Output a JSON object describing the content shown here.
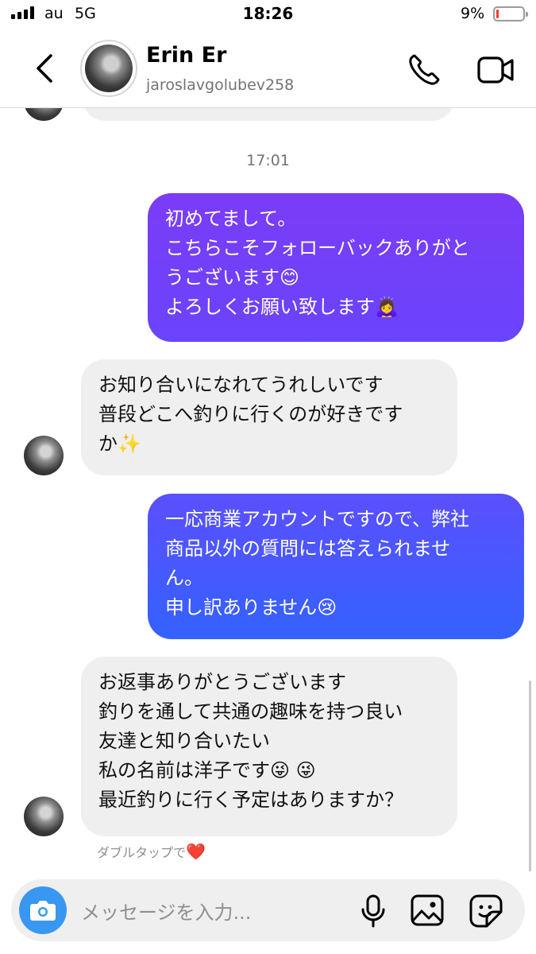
{
  "status_bar": {
    "carrier": "au",
    "network": "5G",
    "time": "18:26",
    "battery_percent": "9%",
    "battery_level": 0.09,
    "battery_color": "#ff3b30"
  },
  "header": {
    "name": "Erin Er",
    "username": "jaroslavgolubev258",
    "back_icon": "chevron-left-icon",
    "call_icon": "phone-icon",
    "video_icon": "video-camera-icon"
  },
  "chat": {
    "timestamp": "17:01",
    "messages": [
      {
        "sender": "me",
        "lines": [
          "初めてまして。",
          "こちらこそフォローバックありがと",
          "うございます😊",
          "よろしくお願い致します🙇‍♀️"
        ]
      },
      {
        "sender": "them",
        "lines": [
          "お知り合いになれてうれしいです",
          "普段どこへ釣りに行くのが好きです",
          "か✨"
        ]
      },
      {
        "sender": "me",
        "lines": [
          "一応商業アカウントですので、弊社",
          "商品以外の質問には答えられませ",
          "ん。",
          "申し訳ありません😢"
        ]
      },
      {
        "sender": "them",
        "lines": [
          "お返事ありがとうございます",
          "釣りを通して共通の趣味を持つ良い",
          "友達と知り合いたい",
          "私の名前は洋子です😜 😜",
          "最近釣りに行く予定はありますか？"
        ]
      }
    ],
    "double_tap_hint": "ダブルタップで",
    "heart": "❤️"
  },
  "composer": {
    "placeholder": "メッセージを入力...",
    "camera_icon": "camera-icon",
    "mic_icon": "microphone-icon",
    "gallery_icon": "image-icon",
    "sticker_icon": "sticker-icon",
    "camera_color": "#3897f0"
  },
  "colors": {
    "outgoing_gradient_top": "#7b3cf7",
    "outgoing_gradient_bottom": "#3462ff",
    "incoming_bubble": "#efefef"
  }
}
